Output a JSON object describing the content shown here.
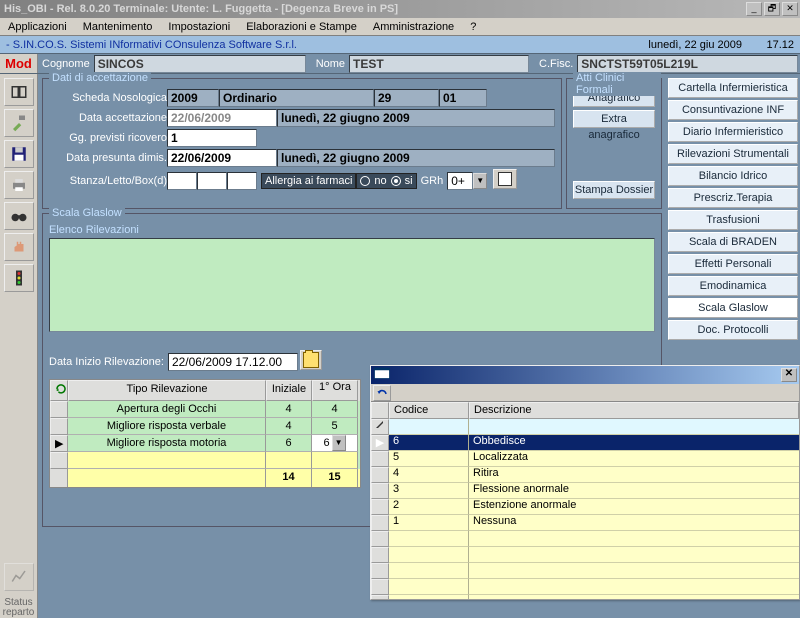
{
  "window": {
    "title": "His_OBI - Rel. 8.0.20 Terminale:  Utente: L. Fuggetta - [Degenza Breve in PS]"
  },
  "menu": {
    "items": [
      "Applicazioni",
      "Mantenimento",
      "Impostazioni",
      "Elaborazioni e Stampe",
      "Amministrazione",
      "?"
    ]
  },
  "subbar": {
    "company": "- S.IN.CO.S. Sistemi INformativi COnsulenza Software S.r.l.",
    "date": "lunedì, 22 giu 2009",
    "time": "17.12"
  },
  "top": {
    "mod": "Mod",
    "cognome_lbl": "Cognome",
    "cognome": "SINCOS",
    "nome_lbl": "Nome",
    "nome": "TEST",
    "cf_lbl": "C.Fisc.",
    "cf": "SNCTST59T05L219L"
  },
  "right_buttons": [
    "Cartella Infermieristica",
    "Consuntivazione INF",
    "Diario Infermieristico",
    "Rilevazioni Strumentali",
    "Bilancio Idrico",
    "Prescriz.Terapia",
    "Trasfusioni",
    "Scala di BRADEN",
    "Effetti Personali",
    "Emodinamica",
    "Scala Glaslow",
    "Doc. Protocolli"
  ],
  "right_selected": 10,
  "atti": {
    "legend": "Atti Clinici Formali",
    "items": [
      "Anagrafico",
      "Extra anagrafico",
      "Stampa Dossier"
    ]
  },
  "accett": {
    "legend": "Dati di accettazione",
    "scheda_lbl": "Scheda Nosologica",
    "scheda": {
      "anno": "2009",
      "tipo": "Ordinario",
      "n1": "29",
      "n2": "01"
    },
    "data_acc_lbl": "Data accettazione",
    "data_acc": "22/06/2009",
    "data_acc_long": "lunedì, 22 giugno 2009",
    "gg_lbl": "Gg. previsti ricovero",
    "gg": "1",
    "data_dim_lbl": "Data presunta dimis.",
    "data_dim": "22/06/2009",
    "data_dim_long": "lunedì, 22 giugno 2009",
    "stanza_lbl": "Stanza/Letto/Box(d)",
    "allergia_lbl": "Allergia ai farmaci",
    "no": "no",
    "si": "si",
    "grh_lbl": "GRh",
    "grh": "0+"
  },
  "glaslow": {
    "legend": "Scala Glaslow",
    "elenco_lbl": "Elenco Rilevazioni",
    "data_inizio_lbl": "Data Inizio Rilevazione:",
    "data_inizio": "22/06/2009 17.12.00",
    "col_tipo": "Tipo Rilevazione",
    "col_iniz": "Iniziale",
    "col_ora": "1° Ora",
    "rows": [
      {
        "tipo": "Apertura degli Occhi",
        "iniz": "4",
        "ora": "4"
      },
      {
        "tipo": "Migliore risposta verbale",
        "iniz": "4",
        "ora": "5"
      },
      {
        "tipo": "Migliore risposta motoria",
        "iniz": "6",
        "ora": "6"
      }
    ],
    "tot_iniz": "14",
    "tot_ora": "15"
  },
  "popup": {
    "col_codice": "Codice",
    "col_descr": "Descrizione",
    "rows": [
      {
        "c": "6",
        "d": "Obbedisce"
      },
      {
        "c": "5",
        "d": "Localizzata"
      },
      {
        "c": "4",
        "d": "Ritira"
      },
      {
        "c": "3",
        "d": "Flessione anormale"
      },
      {
        "c": "2",
        "d": "Estenzione anormale"
      },
      {
        "c": "1",
        "d": "Nessuna"
      }
    ],
    "selected": 0
  },
  "status_label": "Status reparto"
}
